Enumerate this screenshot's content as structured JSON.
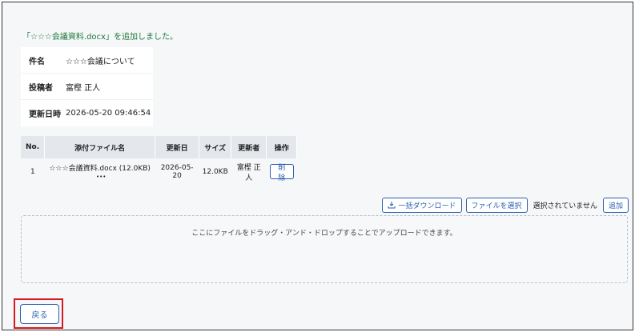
{
  "notice": "「☆☆☆会議資料.docx」を追加しました。",
  "info": {
    "rows": [
      {
        "key": "件名",
        "value": "☆☆☆会議について"
      },
      {
        "key": "投稿者",
        "value": "富樫 正人"
      },
      {
        "key": "更新日時",
        "value": "2026-05-20 09:46:54"
      }
    ]
  },
  "files": {
    "headers": {
      "no": "No.",
      "name": "添付ファイル名",
      "date": "更新日",
      "size": "サイズ",
      "updater": "更新者",
      "action": "操作"
    },
    "rows": [
      {
        "no": "1",
        "name": "☆☆☆会議資料.docx (12.0KB)",
        "more": "•••",
        "date": "2026-05-20",
        "size": "12.0KB",
        "updater": "富樫 正人",
        "delete_label": "削除"
      }
    ]
  },
  "toolbar": {
    "bulk_download_label": "一括ダウンロード",
    "select_file_label": "ファイルを選択",
    "no_file_selected": "選択されていません",
    "add_label": "追加"
  },
  "dropzone": {
    "text": "ここにファイルをドラッグ・アンド・ドロップすることでアップロードできます。"
  },
  "back_label": "戻る",
  "colors": {
    "accent": "#2b5fb0",
    "success": "#1f7a3c",
    "highlight": "#d6191f"
  }
}
